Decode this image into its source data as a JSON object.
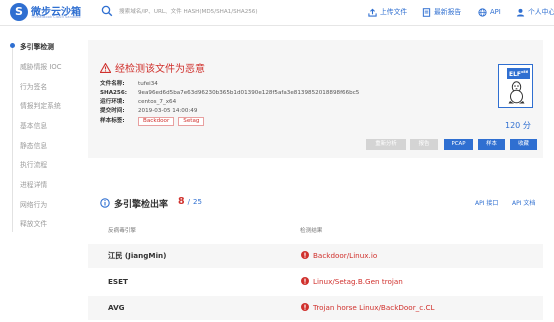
{
  "brand": {
    "logo_letter": "S",
    "name": "微步云沙箱",
    "subtitle": "ThreatBook Cloud Sandbox"
  },
  "search": {
    "placeholder": "搜索域名/IP、URL、文件 HASH(MD5/SHA1/SHA256)"
  },
  "nav": {
    "upload": "上传文件",
    "reports": "最新报告",
    "api": "API",
    "user": "个人中心"
  },
  "sidebar": {
    "items": [
      {
        "label": "多引擎检测",
        "active": true
      },
      {
        "label": "威胁情报 IOC",
        "active": false
      },
      {
        "label": "行为签名",
        "active": false
      },
      {
        "label": "情报判定系统",
        "active": false
      },
      {
        "label": "基本信息",
        "active": false
      },
      {
        "label": "静态信息",
        "active": false
      },
      {
        "label": "执行流程",
        "active": false
      },
      {
        "label": "进程详情",
        "active": false
      },
      {
        "label": "网络行为",
        "active": false
      },
      {
        "label": "释放文件",
        "active": false
      }
    ]
  },
  "verdict": {
    "title": "经检测该文件为恶意",
    "fields": [
      {
        "label": "文件名称:",
        "value": "tufei34"
      },
      {
        "label": "SHA256:",
        "value": "9ea96ed6d5ba7e63d96230b365b1d01390e128f5afa3e8139852018898f66bc5"
      },
      {
        "label": "运行环境:",
        "value": "centos_7_x64"
      },
      {
        "label": "提交时间:",
        "value": "2019-03-05 14:00:49"
      }
    ],
    "tags_label": "样本标签:",
    "tags": [
      "Backdoor",
      "Setag"
    ]
  },
  "file_type": {
    "badge": "ELF",
    "badge_sup": "x86",
    "size": "120 分"
  },
  "actions": {
    "reanalyze": "重新分析",
    "report": "报告",
    "pcap": "PCAP",
    "sample": "样本",
    "favorite": "收藏"
  },
  "detection": {
    "title": "多引擎检出率",
    "hits": "8",
    "separator": "/",
    "total": "25",
    "api_link": "API 接口",
    "api_doc": "API 文档",
    "col_engine": "反病毒引擎",
    "col_result": "检测结果",
    "rows": [
      {
        "engine": "江民 (JiangMin)",
        "result": "Backdoor/Linux.io"
      },
      {
        "engine": "ESET",
        "result": "Linux/Setag.B.Gen trojan"
      },
      {
        "engine": "AVG",
        "result": "Trojan horse Linux/BackDoor_c.CL"
      }
    ]
  },
  "colors": {
    "accent": "#2f6fd1",
    "danger": "#d0312d"
  }
}
